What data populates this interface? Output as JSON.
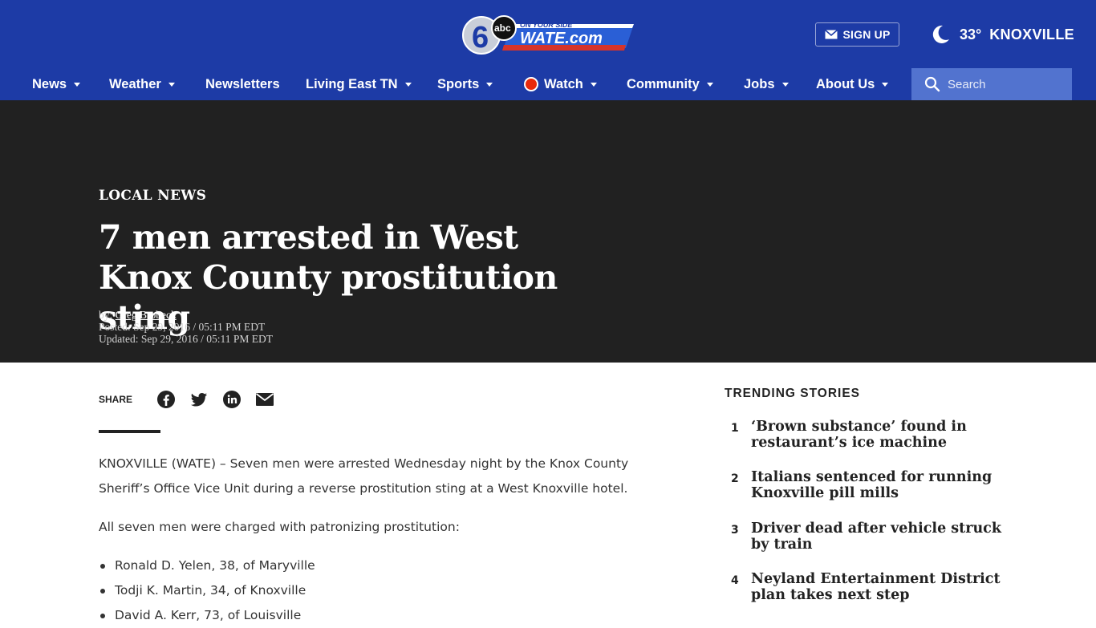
{
  "header": {
    "logo_text": "WATE.com",
    "logo_tagline": "ON YOUR SIDE",
    "logo_network": "abc",
    "logo_channel": "6",
    "signup_label": "SIGN UP",
    "weather_temp": "33°",
    "weather_city": "KNOXVILLE",
    "weather_icon": "moon-icon"
  },
  "nav": {
    "items": [
      {
        "label": "News",
        "has_dropdown": true
      },
      {
        "label": "Weather",
        "has_dropdown": true
      },
      {
        "label": "Newsletters",
        "has_dropdown": false
      },
      {
        "label": "Living East TN",
        "has_dropdown": true
      },
      {
        "label": "Sports",
        "has_dropdown": true
      },
      {
        "label": "Watch",
        "has_dropdown": true,
        "live": true
      },
      {
        "label": "Community",
        "has_dropdown": true
      },
      {
        "label": "Jobs",
        "has_dropdown": true
      },
      {
        "label": "About Us",
        "has_dropdown": true
      }
    ],
    "search_placeholder": "Search"
  },
  "article": {
    "category": "LOCAL NEWS",
    "headline": "7 men arrested in West Knox County prostitution sting",
    "byline_prefix": "by:",
    "author": "Greg Brobeck",
    "posted": "Posted: Sep 29, 2016 / 05:11 PM EDT",
    "updated": "Updated: Sep 29, 2016 / 05:11 PM EDT",
    "share_label": "SHARE",
    "share_icons": [
      "facebook-icon",
      "twitter-icon",
      "linkedin-icon",
      "email-icon"
    ],
    "paragraphs": [
      "KNOXVILLE (WATE) – Seven men were arrested Wednesday night by the Knox County Sheriff’s Office Vice Unit during a reverse prostitution sting at a West Knoxville hotel.",
      "All seven men were charged with patronizing prostitution:"
    ],
    "list": [
      "Ronald D. Yelen, 38, of Maryville",
      "Todji K. Martin, 34, of Knoxville",
      "David A. Kerr, 73, of Louisville"
    ]
  },
  "trending": {
    "title": "TRENDING STORIES",
    "items": [
      {
        "rank": "1",
        "title": "‘Brown substance’ found in restaurant’s ice machine"
      },
      {
        "rank": "2",
        "title": "Italians sentenced for running Knoxville pill mills"
      },
      {
        "rank": "3",
        "title": "Driver dead after vehicle struck by train"
      },
      {
        "rank": "4",
        "title": "Neyland Entertainment District plan takes next step"
      }
    ]
  },
  "colors": {
    "header_bg": "#1d3ba6",
    "search_bg": "#5273cf",
    "hero_bg": "#212121",
    "live_red": "#e8290b"
  }
}
